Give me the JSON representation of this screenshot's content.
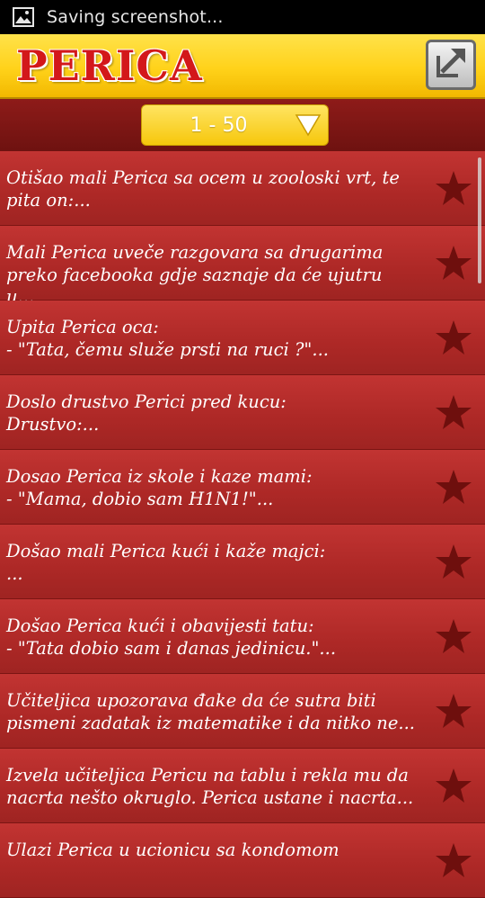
{
  "status_bar": {
    "icon": "image-icon",
    "text": "Saving screenshot..."
  },
  "header": {
    "logo": "PERICA",
    "share_icon": "share-arrow-icon"
  },
  "range_selector": {
    "value": "1 - 50",
    "caret_icon": "triangle-down-icon"
  },
  "jokes": [
    {
      "text": "Otišao mali Perica sa ocem u zooloski vrt, te\npita on:..."
    },
    {
      "text": "Mali Perica uveče razgovara sa drugarima\npreko facebooka gdje saznaje da će ujutru u..."
    },
    {
      "text": "Upita Perica oca:\n- \"Tata, čemu služe prsti na ruci ?\"..."
    },
    {
      "text": "Doslo drustvo Perici pred kucu:\nDrustvo:..."
    },
    {
      "text": "Dosao Perica iz skole i kaze mami:\n- \"Mama, dobio sam H1N1!\"..."
    },
    {
      "text": "Došao mali Perica kući i kaže majci:\n..."
    },
    {
      "text": "Došao Perica kući i obavijesti tatu:\n- \"Tata dobio sam i danas jedinicu.\"..."
    },
    {
      "text": "Učiteljica upozorava đake da će sutra biti\npismeni zadatak iz matematike i da nitko ne..."
    },
    {
      "text": "Izvela učiteljica Pericu na tablu i rekla mu da\nnacrta nešto okruglo. Perica ustane i nacrta..."
    },
    {
      "text": "Ulazi Perica u ucionicu sa kondomom"
    }
  ],
  "colors": {
    "header_yellow": "#ffd21a",
    "logo_red": "#d3181a",
    "row_red": "#b02a28",
    "star_dark": "#6e0f0d"
  }
}
